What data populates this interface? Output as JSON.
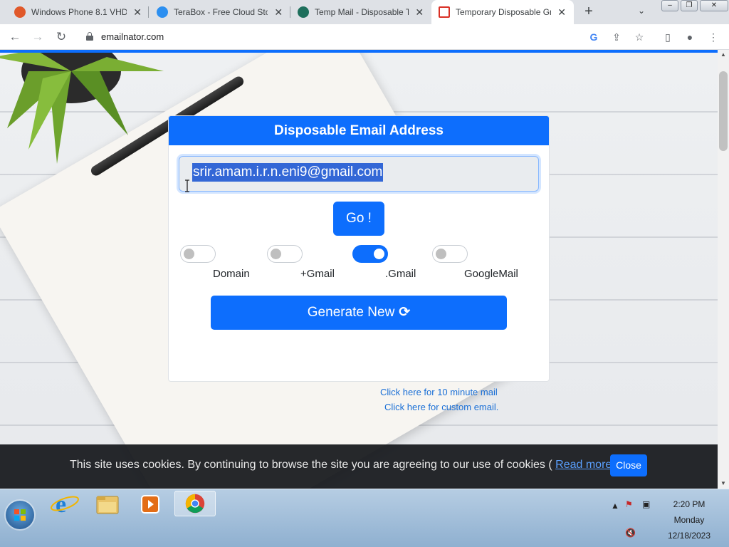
{
  "browser": {
    "tabs": [
      {
        "title": "Windows Phone 8.1 VHD",
        "favicon_color": "#e0582a"
      },
      {
        "title": "TeraBox - Free Cloud Stor",
        "favicon_color": "#2c8ff0"
      },
      {
        "title": "Temp Mail - Disposable Te",
        "favicon_color": "#1e6f5c"
      },
      {
        "title": "Temporary Disposable Gm",
        "favicon_color": "#d93025"
      }
    ],
    "new_tab": "+",
    "url": "emailnator.com"
  },
  "card": {
    "title": "Disposable Email Address",
    "email": "srir.amam.i.r.n.eni9@gmail.com",
    "go_label": "Go !",
    "options": [
      {
        "label": "Domain",
        "on": false
      },
      {
        "label": "+Gmail",
        "on": false
      },
      {
        "label": ".Gmail",
        "on": true
      },
      {
        "label": "GoogleMail",
        "on": false
      }
    ],
    "generate_label": "Generate New",
    "link_10min": "Click here for 10 minute mail",
    "link_custom": "Click here for custom email."
  },
  "cookie": {
    "text": "This site uses cookies. By continuing to browse the site you are agreeing to our use of cookies (",
    "read_more": "Read more",
    "text_end": ")",
    "close_label": "Close"
  },
  "taskbar": {
    "time": "2:20 PM",
    "day": "Monday",
    "date": "12/18/2023"
  },
  "colors": {
    "accent": "#0d6efd",
    "selection": "#3367d6"
  }
}
